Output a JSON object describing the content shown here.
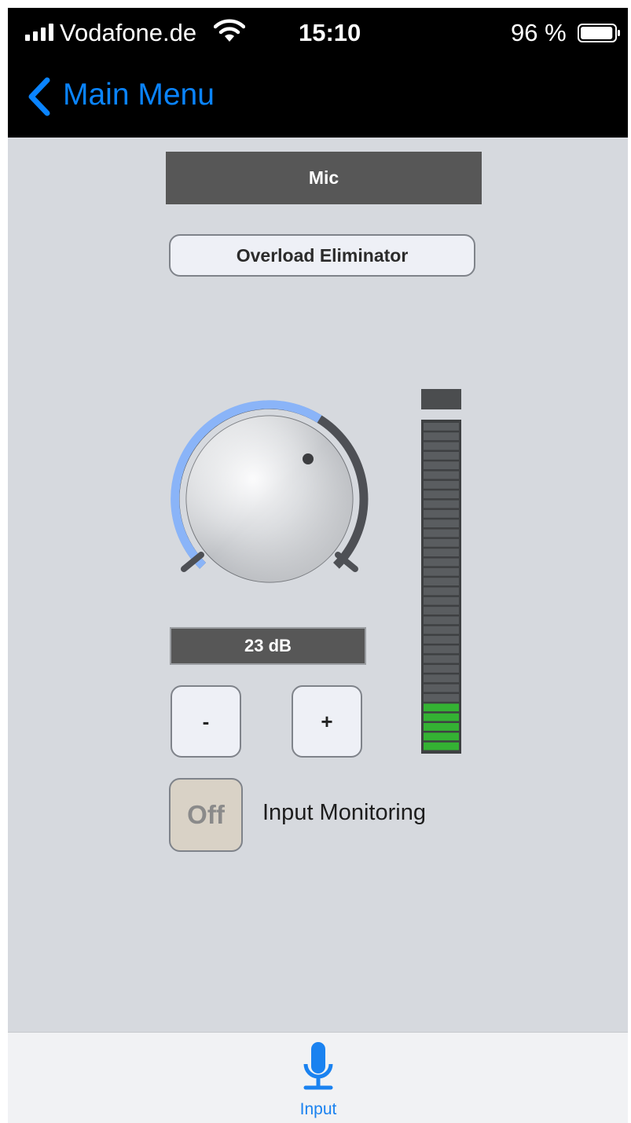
{
  "status_bar": {
    "carrier": "Vodafone.de",
    "time": "15:10",
    "battery_percent": "96 %",
    "battery_level": 0.96,
    "signal_icon": "signal-bars-icon",
    "wifi_icon": "wifi-icon",
    "battery_icon": "battery-icon"
  },
  "nav": {
    "back_label": "Main Menu",
    "back_icon": "chevron-left-icon",
    "accent_color": "#0a84ff"
  },
  "channel": {
    "name": "Mic"
  },
  "overload_button": {
    "label": "Overload Eliminator"
  },
  "gain": {
    "value_label": "23 dB",
    "knob_arc_color": "#8ab4f8",
    "knob_track_color": "#4e5055",
    "decrement_label": "-",
    "increment_label": "+"
  },
  "meter": {
    "segments": 34,
    "lit_segments": 5,
    "lit_color": "#34b233",
    "unlit_color": "#5a5d60"
  },
  "monitoring": {
    "toggle_label": "Off",
    "label": "Input Monitoring"
  },
  "tab_bar": {
    "tabs": [
      {
        "label": "Input",
        "icon": "microphone-icon",
        "active": true
      }
    ]
  }
}
